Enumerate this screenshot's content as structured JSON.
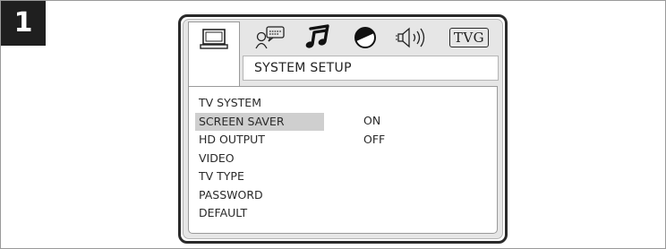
{
  "step": {
    "number": "1"
  },
  "osd": {
    "tabs": [
      {
        "id": "system",
        "icon": "monitor-icon",
        "selected": true
      },
      {
        "id": "language",
        "icon": "speech-bubble-icon",
        "selected": false
      },
      {
        "id": "audio",
        "icon": "music-note-icon",
        "selected": false
      },
      {
        "id": "video",
        "icon": "half-circle-icon",
        "selected": false
      },
      {
        "id": "speaker",
        "icon": "speaker-icon",
        "selected": false
      },
      {
        "id": "rating",
        "icon": "tvg-icon",
        "label": "TVG",
        "selected": false
      }
    ],
    "menu_title": "SYSTEM SETUP",
    "menu_items": [
      "TV SYSTEM",
      "SCREEN SAVER",
      "HD OUTPUT",
      "VIDEO",
      "TV TYPE",
      "PASSWORD",
      "DEFAULT"
    ],
    "selected_item": "SCREEN SAVER",
    "options": [
      "ON",
      "OFF"
    ]
  }
}
